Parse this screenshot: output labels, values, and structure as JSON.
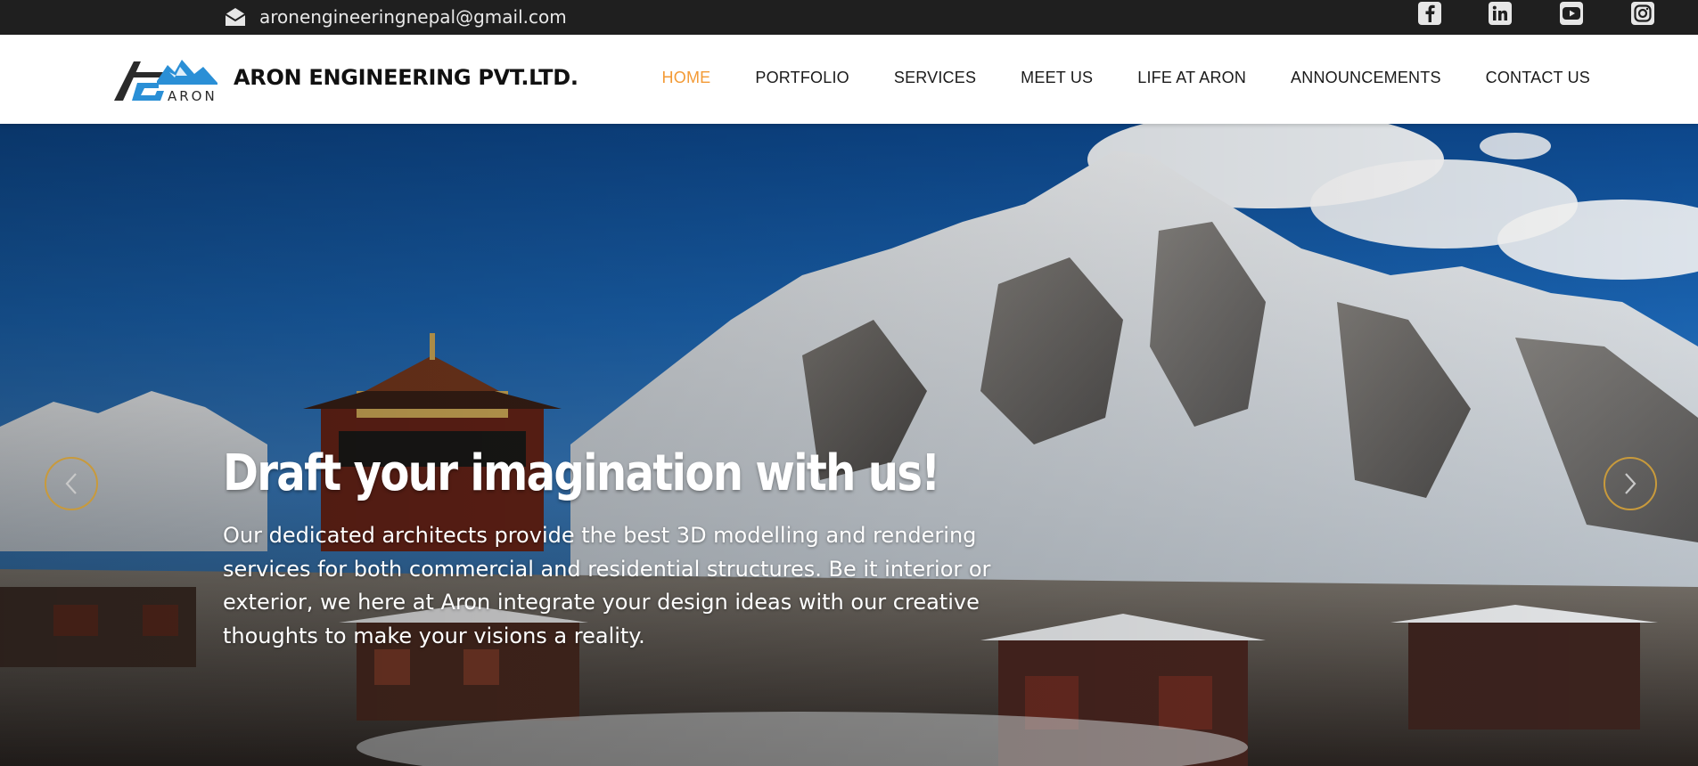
{
  "topbar": {
    "email": "aronengineeringnepal@gmail.com",
    "social_icons": [
      "facebook-icon",
      "linkedin-icon",
      "youtube-icon",
      "instagram-icon"
    ]
  },
  "header": {
    "logo_text": "ARON",
    "brand": "ARON ENGINEERING PVT.LTD.",
    "nav": [
      {
        "label": "HOME",
        "active": true
      },
      {
        "label": "PORTFOLIO"
      },
      {
        "label": "SERVICES"
      },
      {
        "label": "MEET US"
      },
      {
        "label": "LIFE AT ARON"
      },
      {
        "label": "ANNOUNCEMENTS"
      },
      {
        "label": "CONTACT US"
      }
    ]
  },
  "hero": {
    "title": "Draft your imagination with us!",
    "text": "Our dedicated architects provide the best 3D modelling and rendering services for both commercial and residential structures. Be it interior or exterior, we here at Aron integrate your design ideas with our creative thoughts to make your visions a reality.",
    "prev_icon": "chevron-left-icon",
    "next_icon": "chevron-right-icon"
  },
  "colors": {
    "topbar": "#1f1f1f",
    "active_nav": "#f39a35",
    "arrow_border": "#c89a3c",
    "logo_blue": "#2a8fd6"
  }
}
